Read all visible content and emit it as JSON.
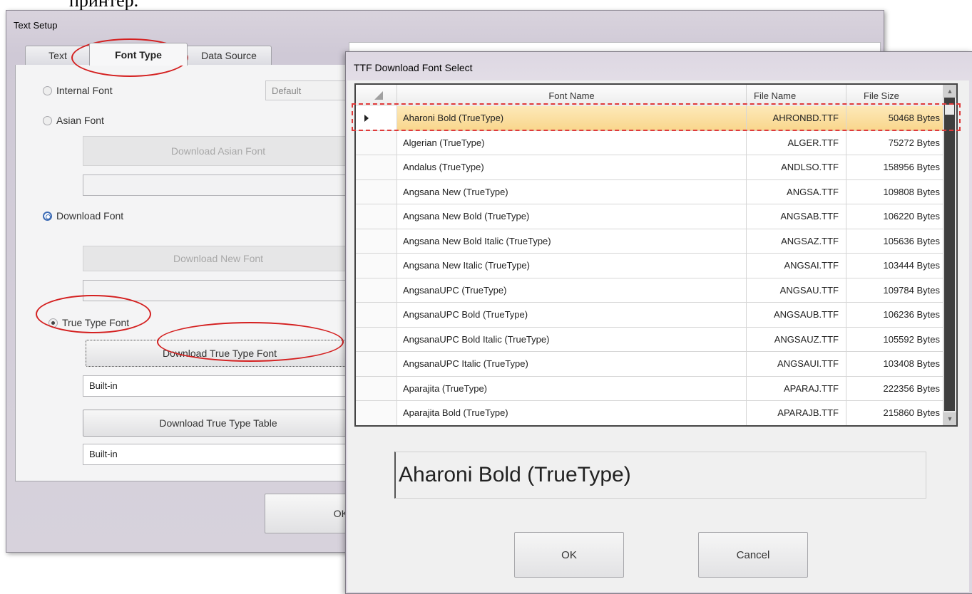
{
  "doc_fragment": "принтер.",
  "text_setup": {
    "title": "Text Setup",
    "tabs": [
      {
        "label": "Text"
      },
      {
        "label": "Font Type"
      },
      {
        "label": "Data Source"
      }
    ],
    "internal_font": {
      "label": "Internal Font",
      "combo_value": "Default"
    },
    "asian_font": {
      "label": "Asian Font",
      "button": "Download Asian Font",
      "field_value": ""
    },
    "download_font": {
      "label": "Download Font",
      "button": "Download New Font",
      "field_value": ""
    },
    "true_type_font": {
      "label": "True Type Font",
      "download_button": "Download True Type Font",
      "font_field_value": "Built-in",
      "table_button": "Download True Type Table",
      "table_field_value": "Built-in"
    },
    "ok_button": "OK"
  },
  "ttf_dialog": {
    "title": "TTF Download Font Select",
    "columns": [
      "Font Name",
      "File Name",
      "File Size"
    ],
    "rows": [
      {
        "name": "Aharoni Bold (TrueType)",
        "file": "AHRONBD.TTF",
        "size": "50468 Bytes",
        "selected": true
      },
      {
        "name": "Algerian (TrueType)",
        "file": "ALGER.TTF",
        "size": "75272 Bytes"
      },
      {
        "name": "Andalus (TrueType)",
        "file": "ANDLSO.TTF",
        "size": "158956 Bytes"
      },
      {
        "name": "Angsana New (TrueType)",
        "file": "ANGSA.TTF",
        "size": "109808 Bytes"
      },
      {
        "name": "Angsana New Bold (TrueType)",
        "file": "ANGSAB.TTF",
        "size": "106220 Bytes"
      },
      {
        "name": "Angsana New Bold Italic (TrueType)",
        "file": "ANGSAZ.TTF",
        "size": "105636 Bytes"
      },
      {
        "name": "Angsana New Italic (TrueType)",
        "file": "ANGSAI.TTF",
        "size": "103444 Bytes"
      },
      {
        "name": "AngsanaUPC (TrueType)",
        "file": "ANGSAU.TTF",
        "size": "109784 Bytes"
      },
      {
        "name": "AngsanaUPC Bold (TrueType)",
        "file": "ANGSAUB.TTF",
        "size": "106236 Bytes"
      },
      {
        "name": "AngsanaUPC Bold Italic (TrueType)",
        "file": "ANGSAUZ.TTF",
        "size": "105592 Bytes"
      },
      {
        "name": "AngsanaUPC Italic (TrueType)",
        "file": "ANGSAUI.TTF",
        "size": "103408 Bytes"
      },
      {
        "name": "Aparajita (TrueType)",
        "file": "APARAJ.TTF",
        "size": "222356 Bytes"
      },
      {
        "name": "Aparajita Bold (TrueType)",
        "file": "APARAJB.TTF",
        "size": "215860 Bytes"
      }
    ],
    "preview_text": "Aharoni Bold (TrueType)",
    "ok_button": "OK",
    "cancel_button": "Cancel"
  },
  "colors": {
    "annotation": "#d42020",
    "selected_row": "#f9d68c"
  }
}
